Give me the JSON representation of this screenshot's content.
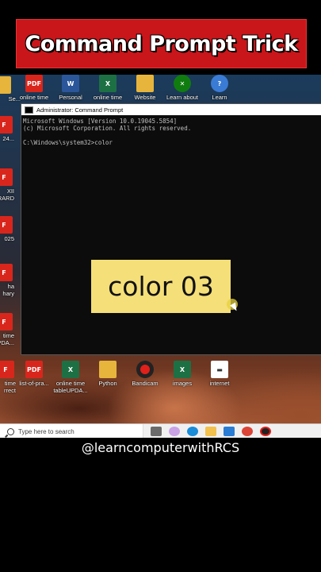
{
  "banner_title": "Command Prompt Trick",
  "desktop": {
    "top_icons": [
      {
        "label": "Se...",
        "icon": "shortcut-icon"
      },
      {
        "label": "online time",
        "icon": "pdf-icon"
      },
      {
        "label": "Personal",
        "icon": "word-icon"
      },
      {
        "label": "online time",
        "icon": "excel-icon"
      },
      {
        "label": "Website",
        "icon": "folder-icon"
      },
      {
        "label": "Learn about",
        "icon": "xbox-icon"
      },
      {
        "label": "Learn",
        "icon": "learn-icon"
      }
    ],
    "left_icons": [
      {
        "label": "24..."
      },
      {
        "label": "XII\nRARD"
      },
      {
        "label": "025"
      },
      {
        "label": "ha\nhary"
      },
      {
        "label": "time\nUPDA..."
      }
    ],
    "bottom_icons": [
      {
        "label": "time\nrrect",
        "icon": "pdf-icon"
      },
      {
        "label": "list-of-pra...",
        "icon": "pdf-icon"
      },
      {
        "label": "online time\ntableUPDA...",
        "icon": "excel-icon"
      },
      {
        "label": "Python",
        "icon": "folder-icon"
      },
      {
        "label": "Bandicam",
        "icon": "record-icon"
      },
      {
        "label": "images",
        "icon": "excel-icon"
      },
      {
        "label": "internet",
        "icon": "web-icon"
      }
    ]
  },
  "cmd": {
    "title": "Administrator: Command Prompt",
    "lines": [
      "Microsoft Windows [Version 10.0.19045.5854]",
      "(c) Microsoft Corporation. All rights reserved.",
      "",
      "C:\\Windows\\system32>color"
    ]
  },
  "caption": "color 03",
  "taskbar": {
    "search_placeholder": "Type here to search"
  },
  "handle": "@learncomputerwithRCS",
  "colors": {
    "banner": "#c8161b",
    "caption_bg": "#f5df78",
    "cmd_bg": "#0c0c0c"
  }
}
